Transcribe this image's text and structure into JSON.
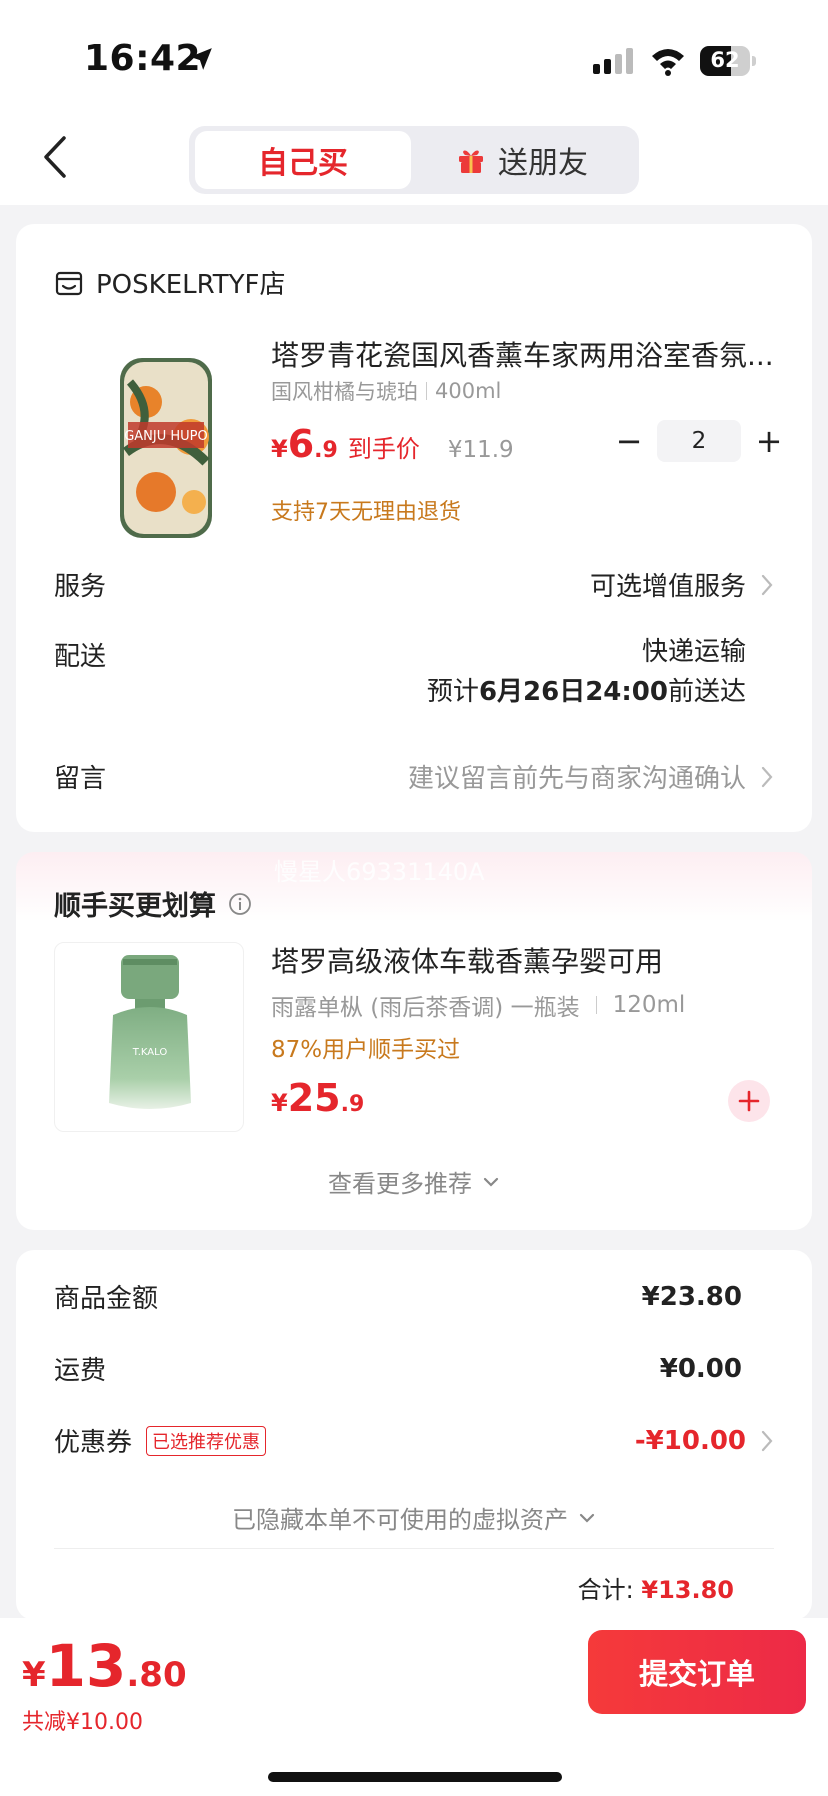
{
  "status": {
    "time": "16:42",
    "battery": "62",
    "battery_level": 0.62
  },
  "nav": {
    "tab_self": "自己买",
    "tab_gift": "送朋友"
  },
  "shop": {
    "name": "POSKELRTYF店",
    "product": {
      "title": "塔罗青花瓷国风香薰车家两用浴室香氛...",
      "spec_flavor": "国风柑橘与琥珀",
      "spec_size": "400ml",
      "price_currency": "¥",
      "price_int": "6",
      "price_dec": ".9",
      "price_tag": "到手价",
      "original_price": "¥11.9",
      "quantity": "2",
      "minus": "−",
      "plus": "+",
      "return_policy": "支持7天无理由退货"
    },
    "service_label": "服务",
    "service_value": "可选增值服务",
    "delivery_label": "配送",
    "delivery_method": "快递运输",
    "delivery_eta_prefix": "预计",
    "delivery_eta": "6月26日24:00",
    "delivery_eta_suffix": "前送达",
    "note_label": "留言",
    "note_placeholder": "建议留言前先与商家沟通确认"
  },
  "recommend": {
    "watermark": "慢星人69331140A",
    "title": "顺手买更划算",
    "item": {
      "name": "塔罗高级液体车载香薰孕婴可用",
      "spec": "雨露单枞 (雨后茶香调) 一瓶装",
      "size": "120ml",
      "note": "87%用户顺手买过",
      "price_currency": "¥",
      "price_int": "25",
      "price_dec": ".9"
    },
    "more": "查看更多推荐"
  },
  "summary": {
    "goods_label": "商品金额",
    "goods_value": "¥23.80",
    "shipping_label": "运费",
    "shipping_value": "¥0.00",
    "coupon_label": "优惠券",
    "coupon_tag": "已选推荐优惠",
    "coupon_value": "-¥10.00",
    "hidden_assets": "已隐藏本单不可使用的虚拟资产",
    "total_label": "合计:",
    "total_value": "¥13.80"
  },
  "footer": {
    "currency": "¥",
    "total_int": "13",
    "total_dec": ".80",
    "saved": "共减¥10.00",
    "submit": "提交订单"
  },
  "colors": {
    "accent": "#e5262c",
    "warn": "#c8791d"
  }
}
